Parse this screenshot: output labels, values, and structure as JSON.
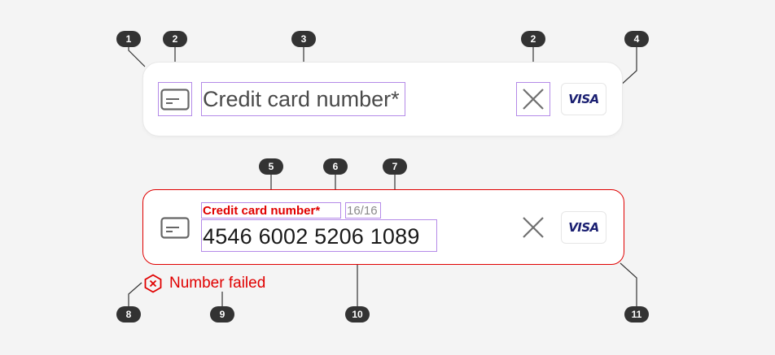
{
  "default_field": {
    "placeholder": "Credit card number*",
    "brand": "VISA"
  },
  "error_field": {
    "label": "Credit card number*",
    "counter": "16/16",
    "value": "4546 6002 5206 1089",
    "brand": "VISA",
    "error_message": "Number failed"
  },
  "colors": {
    "error": "#e00000",
    "annotation_box": "#b48ae8",
    "marker": "#333333",
    "visa_blue": "#1a1f71"
  },
  "markers": [
    "1",
    "2",
    "3",
    "2",
    "4",
    "5",
    "6",
    "7",
    "8",
    "9",
    "10",
    "11"
  ]
}
